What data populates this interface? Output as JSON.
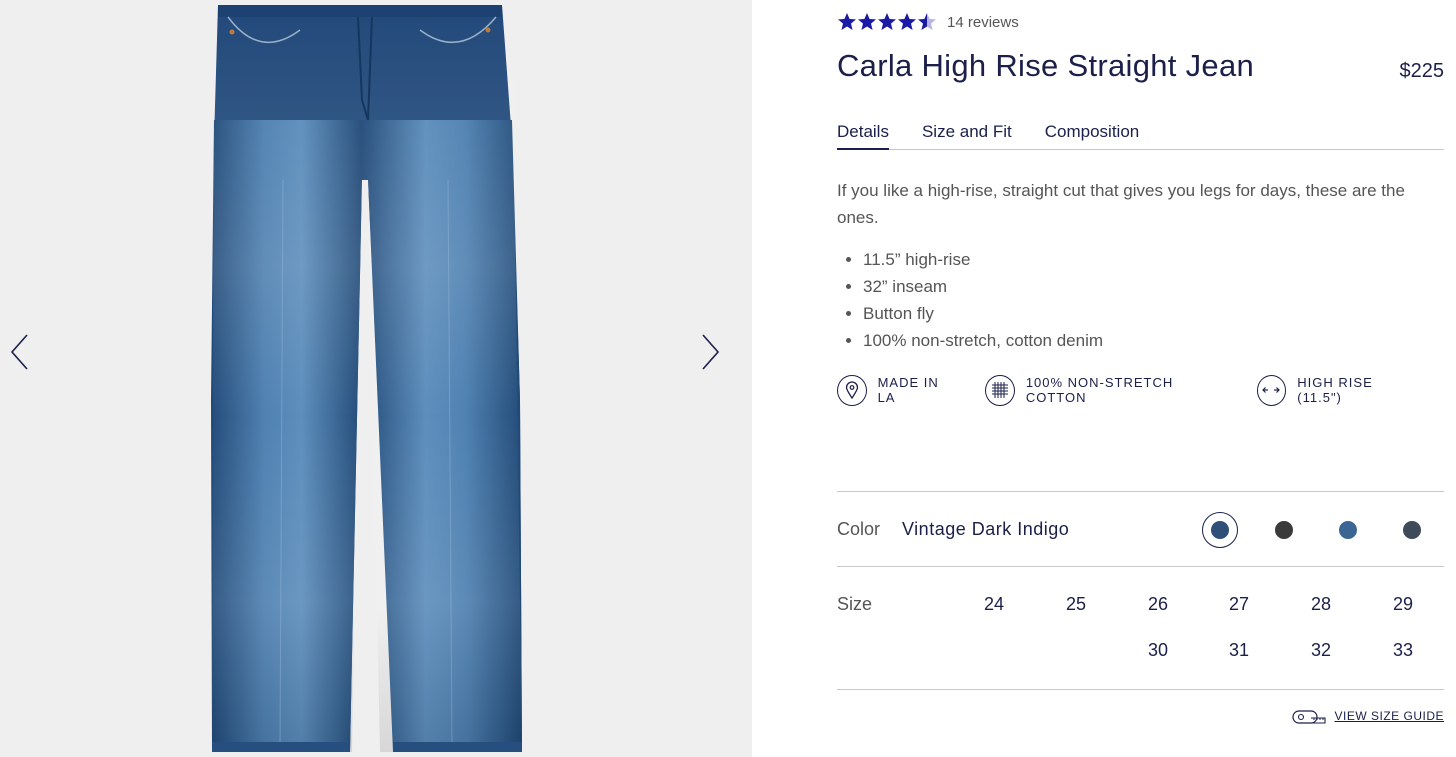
{
  "gallery": {
    "prev_icon": "chevron-left-icon",
    "next_icon": "chevron-right-icon",
    "product_image": "straight-leg-jeans"
  },
  "product": {
    "rating": 4.5,
    "rating_max": 5,
    "reviews_label": "14 reviews",
    "title": "Carla High Rise Straight Jean",
    "price": "$225",
    "star_color": "#1a1aa6"
  },
  "tabs": [
    {
      "label": "Details",
      "active": true
    },
    {
      "label": "Size and Fit",
      "active": false
    },
    {
      "label": "Composition",
      "active": false
    }
  ],
  "details": {
    "description": "If you like a high-rise, straight cut that gives you legs for days, these are the ones.",
    "bullets": [
      "11.5” high-rise",
      "32” inseam",
      "Button fly",
      "100% non-stretch, cotton denim"
    ]
  },
  "features": [
    {
      "icon": "location-pin-icon",
      "label": "MADE IN LA"
    },
    {
      "icon": "fabric-weave-icon",
      "label": "100% NON-STRETCH COTTON"
    },
    {
      "icon": "arrows-horizontal-icon",
      "label": "HIGH RISE (11.5\")"
    }
  ],
  "color": {
    "label": "Color",
    "value": "Vintage Dark Indigo",
    "swatches": [
      {
        "hex": "#2e4f78",
        "selected": true
      },
      {
        "hex": "#3a3a3a",
        "selected": false
      },
      {
        "hex": "#3b6592",
        "selected": false
      },
      {
        "hex": "#3e4a58",
        "selected": false
      }
    ]
  },
  "size": {
    "label": "Size",
    "row1": [
      "24",
      "25",
      "26",
      "27",
      "28",
      "29"
    ],
    "row2": [
      "30",
      "31",
      "32",
      "33"
    ]
  },
  "size_guide": {
    "icon": "measuring-tape-icon",
    "label": "VIEW SIZE GUIDE"
  }
}
